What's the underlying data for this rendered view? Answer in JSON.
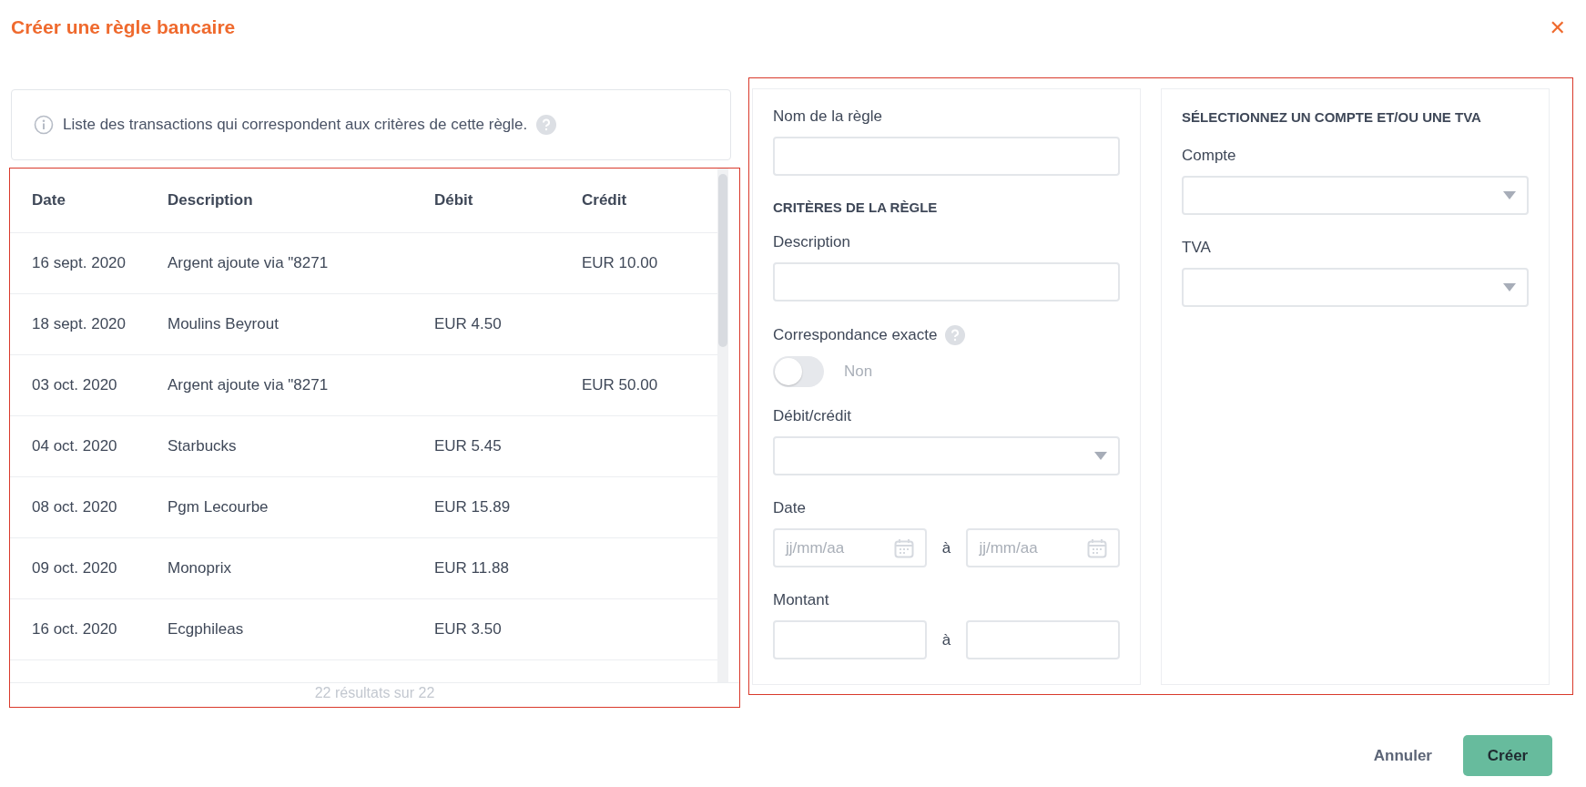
{
  "dialog": {
    "title": "Créer une règle bancaire",
    "close": "✕"
  },
  "info": {
    "text": "Liste des transactions qui correspondent aux critères de cette règle."
  },
  "table": {
    "columns": [
      "Date",
      "Description",
      "Débit",
      "Crédit"
    ],
    "rows": [
      {
        "date": "16 sept. 2020",
        "description": "Argent ajoute via \"8271",
        "debit": "",
        "credit": "EUR 10.00"
      },
      {
        "date": "18 sept. 2020",
        "description": "Moulins Beyrout",
        "debit": "EUR 4.50",
        "credit": ""
      },
      {
        "date": "03 oct. 2020",
        "description": "Argent ajoute via \"8271",
        "debit": "",
        "credit": "EUR 50.00"
      },
      {
        "date": "04 oct. 2020",
        "description": "Starbucks",
        "debit": "EUR 5.45",
        "credit": ""
      },
      {
        "date": "08 oct. 2020",
        "description": "Pgm Lecourbe",
        "debit": "EUR 15.89",
        "credit": ""
      },
      {
        "date": "09 oct. 2020",
        "description": "Monoprix",
        "debit": "EUR 11.88",
        "credit": ""
      },
      {
        "date": "16 oct. 2020",
        "description": "Ecgphileas",
        "debit": "EUR 3.50",
        "credit": ""
      }
    ],
    "footer": "22 résultats sur 22"
  },
  "rule_form": {
    "name_label": "Nom de la règle",
    "criteria_heading": "CRITÈRES DE LA RÈGLE",
    "description_label": "Description",
    "exact_match": {
      "label": "Correspondance exacte",
      "on": false,
      "state_text": "Non"
    },
    "debit_credit_label": "Débit/crédit",
    "date": {
      "label": "Date",
      "from_placeholder": "jj/mm/aa",
      "separator": "à",
      "to_placeholder": "jj/mm/aa"
    },
    "amount": {
      "label": "Montant",
      "separator": "à"
    }
  },
  "account_panel": {
    "heading": "SÉLECTIONNEZ UN COMPTE ET/OU UNE TVA",
    "account_label": "Compte",
    "vat_label": "TVA"
  },
  "buttons": [
    {
      "label": "Annuler",
      "kind": "secondary"
    },
    {
      "label": "Créer",
      "kind": "primary"
    }
  ]
}
